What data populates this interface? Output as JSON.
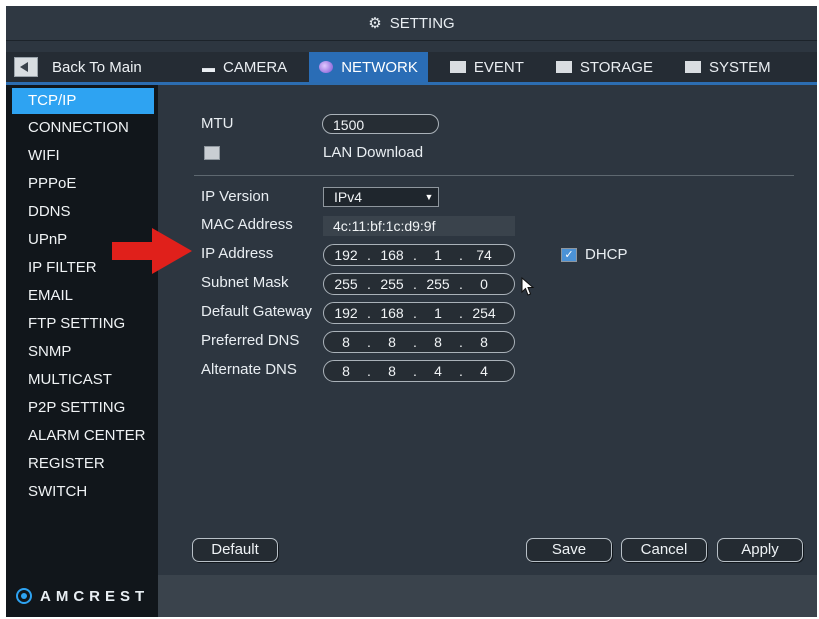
{
  "window": {
    "title": "SETTING",
    "title_icon": "gear-icon"
  },
  "nav": {
    "back_label": "Back To Main",
    "tabs": [
      {
        "label": "CAMERA",
        "icon": "camera-icon"
      },
      {
        "label": "NETWORK",
        "icon": "globe-icon",
        "active": true
      },
      {
        "label": "EVENT",
        "icon": "event-icon"
      },
      {
        "label": "STORAGE",
        "icon": "storage-icon"
      },
      {
        "label": "SYSTEM",
        "icon": "system-icon"
      }
    ]
  },
  "sidebar": {
    "items": [
      {
        "label": "TCP/IP",
        "active": true
      },
      {
        "label": "CONNECTION"
      },
      {
        "label": "WIFI"
      },
      {
        "label": "PPPoE"
      },
      {
        "label": "DDNS"
      },
      {
        "label": "UPnP"
      },
      {
        "label": "IP FILTER"
      },
      {
        "label": "EMAIL"
      },
      {
        "label": "FTP SETTING"
      },
      {
        "label": "SNMP"
      },
      {
        "label": "MULTICAST"
      },
      {
        "label": "P2P SETTING"
      },
      {
        "label": "ALARM CENTER"
      },
      {
        "label": "REGISTER"
      },
      {
        "label": "SWITCH"
      }
    ]
  },
  "brand": {
    "name": "AMCREST"
  },
  "form": {
    "mtu": {
      "label": "MTU",
      "value": "1500"
    },
    "lan_download": {
      "label": "LAN Download",
      "checked": false
    },
    "ip_version": {
      "label": "IP Version",
      "value": "IPv4"
    },
    "mac": {
      "label": "MAC Address",
      "value": "4c:11:bf:1c:d9:9f"
    },
    "ip_address": {
      "label": "IP Address",
      "octets": [
        "192",
        "168",
        "1",
        "74"
      ]
    },
    "dhcp": {
      "label": "DHCP",
      "checked": true
    },
    "subnet_mask": {
      "label": "Subnet Mask",
      "octets": [
        "255",
        "255",
        "255",
        "0"
      ]
    },
    "default_gateway": {
      "label": "Default Gateway",
      "octets": [
        "192",
        "168",
        "1",
        "254"
      ]
    },
    "preferred_dns": {
      "label": "Preferred DNS",
      "octets": [
        "8",
        "8",
        "8",
        "8"
      ]
    },
    "alternate_dns": {
      "label": "Alternate DNS",
      "octets": [
        "8",
        "8",
        "4",
        "4"
      ]
    }
  },
  "buttons": {
    "default": "Default",
    "save": "Save",
    "cancel": "Cancel",
    "apply": "Apply"
  },
  "colors": {
    "accent": "#2ea3f2",
    "tab_active": "#2a6db6",
    "annotation_arrow": "#e0201b"
  }
}
